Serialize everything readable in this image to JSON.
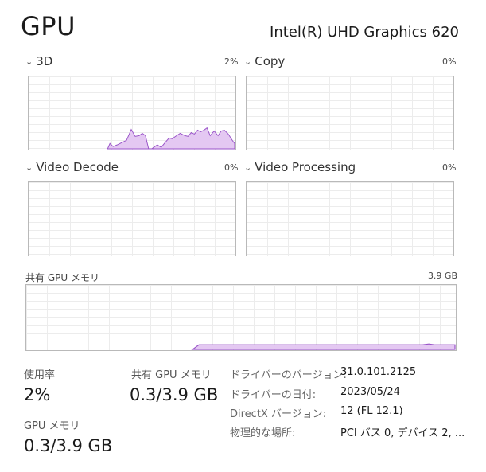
{
  "header": {
    "title": "GPU",
    "device": "Intel(R) UHD Graphics 620"
  },
  "engines": [
    {
      "name": "3D",
      "percent": "2%"
    },
    {
      "name": "Copy",
      "percent": "0%"
    },
    {
      "name": "Video Decode",
      "percent": "0%"
    },
    {
      "name": "Video Processing",
      "percent": "0%"
    }
  ],
  "shared_memory": {
    "label": "共有 GPU メモリ",
    "max": "3.9 GB"
  },
  "stats": {
    "utilization_label": "使用率",
    "utilization_value": "2%",
    "shared_label": "共有 GPU メモリ",
    "shared_value": "0.3/3.9 GB",
    "gpu_mem_label": "GPU メモリ",
    "gpu_mem_value": "0.3/3.9 GB"
  },
  "details": [
    {
      "label": "ドライバーのバージョン:",
      "value": "31.0.101.2125"
    },
    {
      "label": "ドライバーの日付:",
      "value": "2023/05/24"
    },
    {
      "label": "DirectX バージョン:",
      "value": "12 (FL 12.1)"
    },
    {
      "label": "物理的な場所:",
      "value": "PCI バス 0, デバイス 2, ..."
    }
  ],
  "colors": {
    "graph_fill": "#e4c8f2",
    "graph_line": "#9a55c9",
    "grid": "#ececec",
    "border": "#b9b9b9"
  }
}
